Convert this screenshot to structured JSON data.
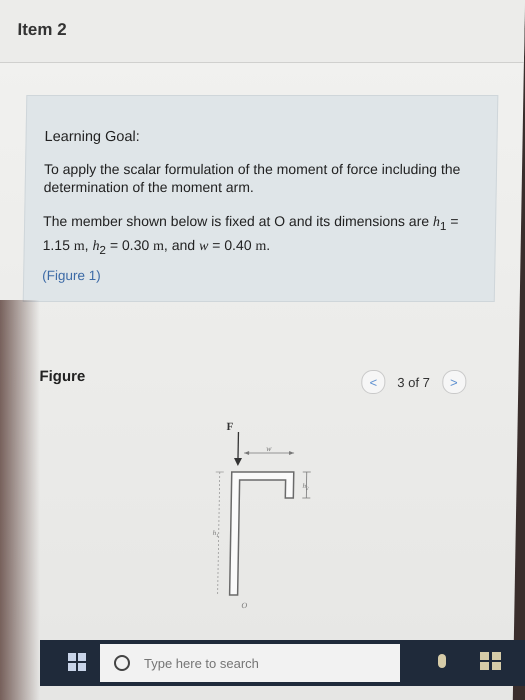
{
  "header": {
    "title": "Item 2"
  },
  "goal": {
    "heading": "Learning Goal:",
    "text": "To apply the scalar formulation of the moment of force including the determination of the moment arm.",
    "member_prefix": "The member shown below is fixed at O and its dimensions are ",
    "h1_symbol": "h",
    "h1_sub": "1",
    "h1_value": " = 1.15 ",
    "h1_unit": "m",
    "h2_symbol": "h",
    "h2_sub": "2",
    "h2_value": " = 0.30 ",
    "h2_unit": "m",
    "and_text": ", and ",
    "w_symbol": "w",
    "w_value": " = 0.40 ",
    "w_unit": "m",
    "figure_link": "(Figure 1)"
  },
  "figure_panel": {
    "title": "Figure",
    "prev": "<",
    "next": ">",
    "page_label": "3 of 7"
  },
  "diagram": {
    "force_label": "F",
    "w_label": "w",
    "h1_label": "h",
    "h1_sub": "1",
    "h2_label": "h",
    "h2_sub": "2",
    "origin_label": "O"
  },
  "taskbar": {
    "search_placeholder": "Type here to search"
  }
}
